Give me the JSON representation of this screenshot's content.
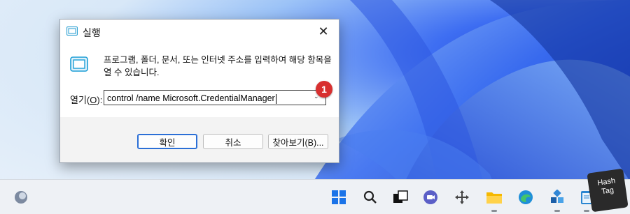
{
  "dialog": {
    "title": "실행",
    "close_glyph": "✕",
    "description": "프로그램, 폴더, 문서, 또는 인터넷 주소를 입력하여 해당 항목을 열 수 있습니다.",
    "open_label_prefix": "열기(",
    "open_label_key": "O",
    "open_label_suffix": "):",
    "command_value": "control /name Microsoft.CredentialManager",
    "dropdown_glyph": "⌄",
    "buttons": {
      "ok": "확인",
      "cancel": "취소",
      "browse": "찾아보기(B)..."
    }
  },
  "annotation": {
    "step_number": "1",
    "color": "#d83030"
  },
  "taskbar": {
    "items": [
      "weather-icon",
      "start-icon",
      "search-icon",
      "task-view-icon",
      "chat-icon",
      "move-icon",
      "file-explorer-icon",
      "edge-icon",
      "app-icon",
      "notepad-icon"
    ]
  },
  "watermark": {
    "line1": "Hash",
    "line2": "Tag"
  },
  "colors": {
    "accent": "#2b6fd6",
    "badge": "#d83030"
  }
}
